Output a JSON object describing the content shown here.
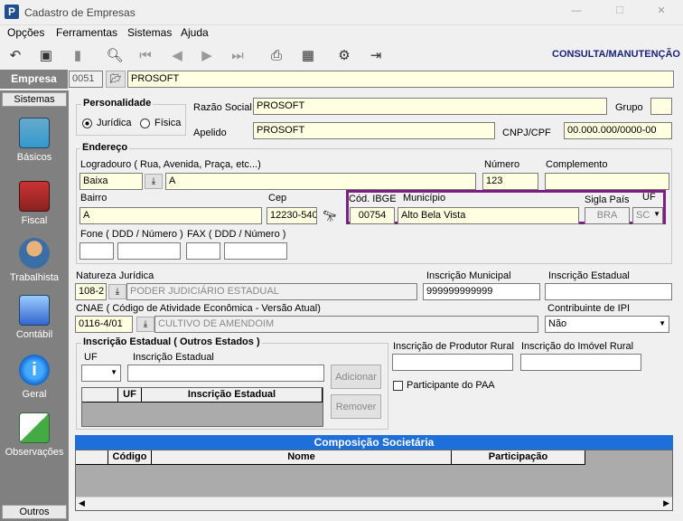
{
  "window": {
    "title": "Cadastro de Empresas",
    "minimize": "—",
    "maximize": "☐",
    "close": "✕"
  },
  "menu": [
    "Opções",
    "Ferramentas",
    "Sistemas",
    "Ajuda"
  ],
  "toolbar": {
    "mode_label": "CONSULTA/MANUTENÇÃO"
  },
  "company": {
    "label": "Empresa",
    "code": "0051",
    "name": "PROSOFT"
  },
  "sidebar": {
    "tab_top": "Sistemas",
    "items": [
      "Básicos",
      "Fiscal",
      "Trabalhista",
      "Contábil",
      "Geral",
      "Observações"
    ],
    "tab_bottom": "Outros"
  },
  "personalidade": {
    "title": "Personalidade",
    "option1": "Jurídica",
    "option2": "Física",
    "selected": "Jurídica"
  },
  "razao_social": {
    "label": "Razão Social",
    "value": "PROSOFT"
  },
  "grupo": {
    "label": "Grupo",
    "value": ""
  },
  "apelido": {
    "label": "Apelido",
    "value": "PROSOFT"
  },
  "cnpj": {
    "label": "CNPJ/CPF",
    "value": "00.000.000/0000-00"
  },
  "endereco": {
    "title": "Endereço",
    "logradouro_label": "Logradouro ( Rua, Avenida, Praça, etc...)",
    "logradouro_tipo": "Baixa",
    "logradouro_value": "A",
    "numero_label": "Número",
    "numero_value": "123",
    "complemento_label": "Complemento",
    "complemento_value": "",
    "bairro_label": "Bairro",
    "bairro_value": "A",
    "cep_label": "Cep",
    "cep_value": "12230-540",
    "ibge_label": "Cód. IBGE",
    "ibge_value": "00754",
    "municipio_label": "Município",
    "municipio_value": "Alto Bela Vista",
    "sigla_pais_label": "Sigla País",
    "sigla_pais_value": "BRA",
    "uf_label": "UF",
    "uf_value": "SC",
    "fone_label": "Fone ( DDD / Número )",
    "fax_label": "FAX ( DDD / Número )"
  },
  "natureza": {
    "label": "Natureza Jurídica",
    "code": "108-2",
    "desc": "PODER JUDICIÁRIO ESTADUAL"
  },
  "inscricao_municipal": {
    "label": "Inscrição Municipal",
    "value": "999999999999"
  },
  "inscricao_estadual": {
    "label": "Inscrição Estadual",
    "value": ""
  },
  "cnae": {
    "label": "CNAE ( Código de Atividade Econômica - Versão Atual)",
    "code": "0116-4/01",
    "desc": "CULTIVO DE AMENDOIM"
  },
  "contribuinte_ipi": {
    "label": "Contribuinte de IPI",
    "value": "Não"
  },
  "ie_outros": {
    "title": "Inscrição Estadual ( Outros Estados )",
    "uf_label": "UF",
    "ie_label": "Inscrição Estadual",
    "add_button": "Adicionar",
    "remove_button": "Remover",
    "col_uf": "UF",
    "col_ie": "Inscrição Estadual"
  },
  "produtor_rural": {
    "label": "Inscrição de Produtor Rural",
    "value": ""
  },
  "imovel_rural": {
    "label": "Inscrição do Imóvel Rural",
    "value": ""
  },
  "paa": {
    "label": "Participante do PAA"
  },
  "composicao": {
    "title": "Composição Societária",
    "col_codigo": "Código",
    "col_nome": "Nome",
    "col_participacao": "Participação"
  },
  "colors": {
    "title_blue": "#1e6fd9",
    "highlight_purple": "#7b1f83",
    "sidebar_gray": "#808080",
    "field_yellow": "#ffffe1"
  }
}
